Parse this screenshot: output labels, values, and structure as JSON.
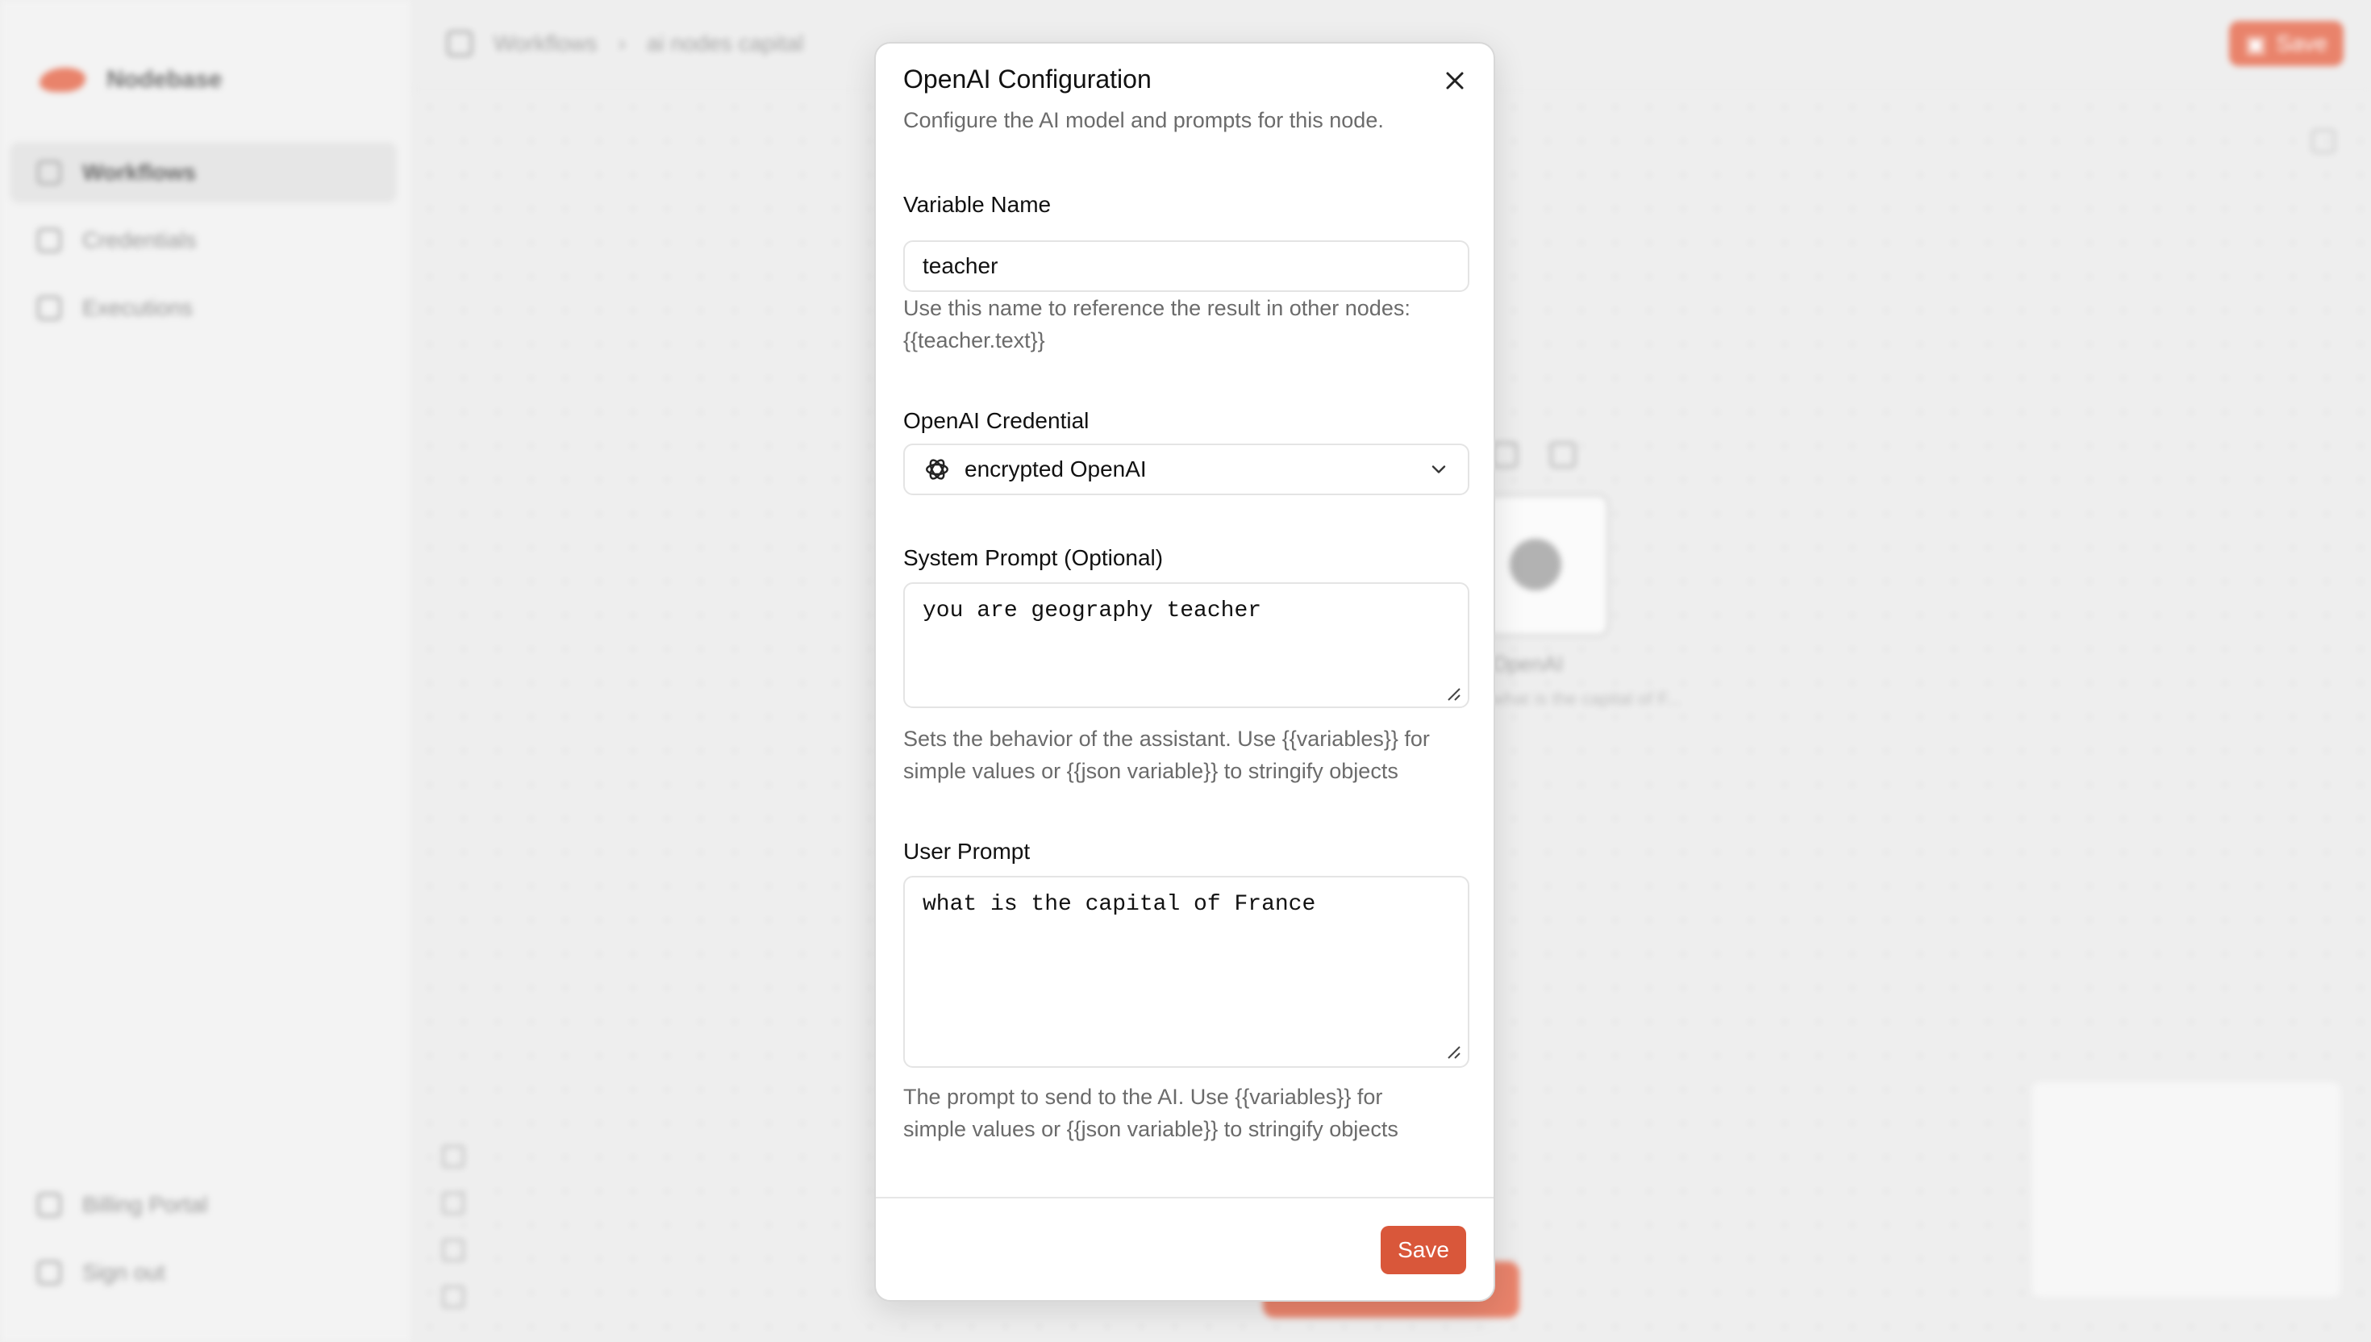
{
  "background": {
    "brand_name": "Nodebase",
    "nav": [
      {
        "label": "Workflows",
        "active": true
      },
      {
        "label": "Credentials",
        "active": false
      },
      {
        "label": "Executions",
        "active": false
      }
    ],
    "nav_bottom": [
      {
        "label": "Billing Portal"
      },
      {
        "label": "Sign out"
      }
    ],
    "breadcrumb": [
      "Workflows",
      "ai nodes capital"
    ],
    "top_save_label": "Save",
    "node": {
      "label": "OpenAI",
      "sub": "what is the capital of F..."
    }
  },
  "modal": {
    "title": "OpenAI Configuration",
    "description": "Configure the AI model and prompts for this node.",
    "variable_name": {
      "label": "Variable Name",
      "value": "teacher",
      "help_line1": "Use this name to reference the result in other nodes:",
      "help_line2": "{{teacher.text}}"
    },
    "credential": {
      "label": "OpenAI Credential",
      "value": "encrypted OpenAI"
    },
    "system_prompt": {
      "label": "System Prompt (Optional)",
      "value": "you are geography teacher",
      "help_line1": "Sets the behavior of the assistant. Use {{variables}} for",
      "help_line2": "simple values or {{json variable}} to stringify objects"
    },
    "user_prompt": {
      "label": "User Prompt",
      "value": "what is the capital of France",
      "help_line1": "The prompt to send to the AI. Use {{variables}} for",
      "help_line2": "simple values or {{json variable}} to stringify objects"
    },
    "save_label": "Save"
  },
  "colors": {
    "accent": "#d9573a",
    "muted_text": "#6b6b6b",
    "border": "#e4e4e4"
  }
}
